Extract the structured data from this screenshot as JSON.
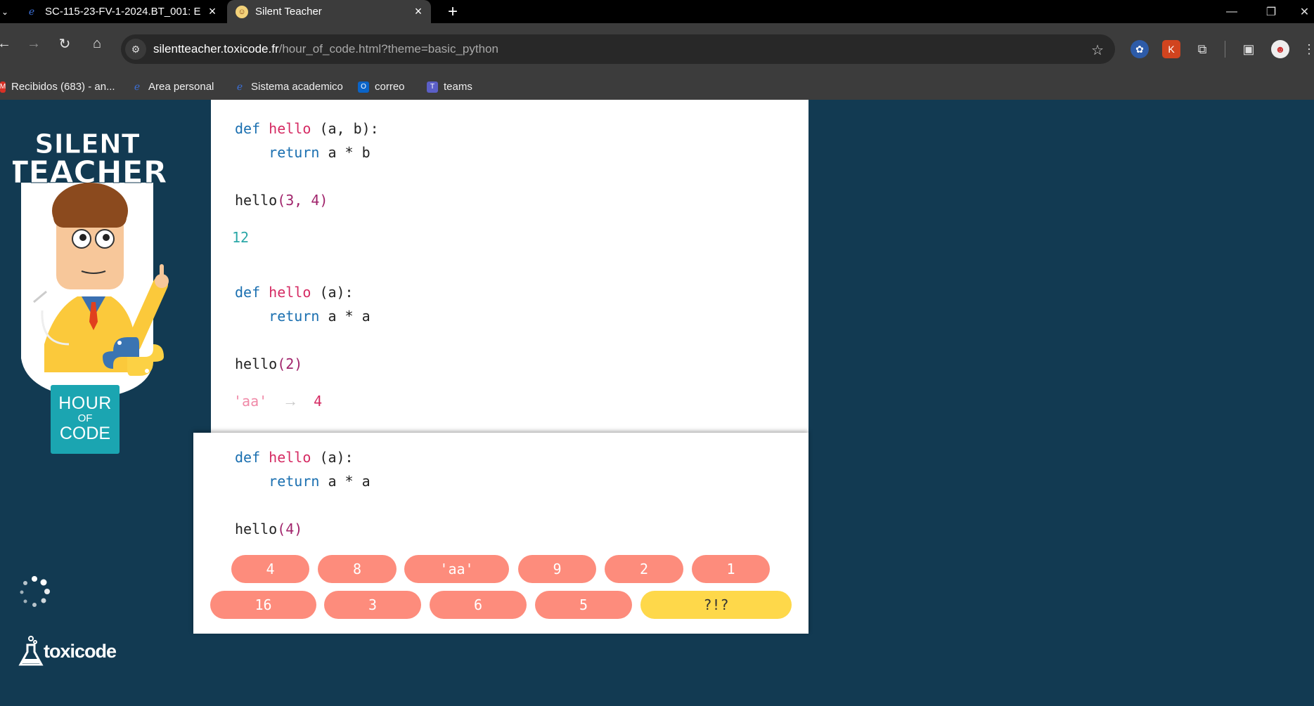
{
  "browser": {
    "tabs": [
      {
        "title": "SC-115-23-FV-1-2024.BT_001: E",
        "active": false
      },
      {
        "title": "Silent Teacher",
        "active": true
      }
    ],
    "new_tab_label": "+",
    "url_host": "silentteacher.toxicode.fr",
    "url_path": "/hour_of_code.html?theme=basic_python",
    "bookmarks": [
      {
        "label": "Recibidos (683) - an..."
      },
      {
        "label": "Area personal"
      },
      {
        "label": "Sistema academico"
      },
      {
        "label": "correo"
      },
      {
        "label": "teams"
      }
    ]
  },
  "sidebar": {
    "logo_line1": "SILENT",
    "logo_line2": "TEACHER",
    "hoc_line1": "HOUR",
    "hoc_line2": "OF",
    "hoc_line3": "CODE",
    "brand": "toxicode"
  },
  "exercises": [
    {
      "def_keyword": "def",
      "func_name": "hello",
      "params": "(a, b):",
      "return_keyword": "return",
      "body_expr": "a * b",
      "call_name": "hello",
      "call_args": "(3, 4)",
      "result": "12"
    },
    {
      "def_keyword": "def",
      "func_name": "hello",
      "params": "(a):",
      "return_keyword": "return",
      "body_expr": "a * a",
      "call_name": "hello",
      "call_args": "(2)",
      "wrong_answer": "'aa'",
      "arrow": "→",
      "correct_answer": "4"
    },
    {
      "def_keyword": "def",
      "func_name": "hello",
      "params": "(a):",
      "return_keyword": "return",
      "body_expr": "a * a",
      "call_name": "hello",
      "call_args": "(4)"
    }
  ],
  "choices_row1": [
    "4",
    "8",
    "'aa'",
    "9",
    "2",
    "1"
  ],
  "choices_row2": [
    "16",
    "3",
    "6",
    "5",
    "?!?"
  ],
  "colors": {
    "page_bg": "#123a52",
    "choice": "#fd8c7c",
    "choice_special": "#fed84a",
    "keyword": "#1a6fb0",
    "function": "#d52b63",
    "result": "#2aa7a7"
  }
}
